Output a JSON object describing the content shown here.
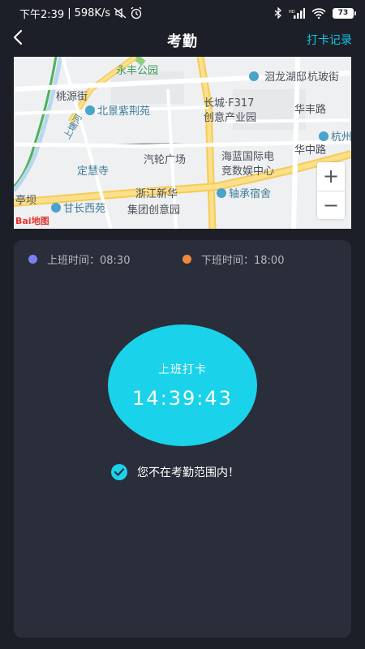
{
  "status_bar": {
    "time": "下午2:39",
    "network_speed": "598K/s",
    "battery": "73",
    "icons": [
      "mute-icon",
      "alarm-icon",
      "bluetooth-icon",
      "signal-icon",
      "wifi-icon",
      "battery-icon"
    ]
  },
  "nav": {
    "title": "考勤",
    "action_label": "打卡记录",
    "back_icon": "chevron-left-icon"
  },
  "map": {
    "pois": [
      "永丰公园",
      "洄龙湖邸",
      "杭玻街",
      "桃源街",
      "北景紫荆苑",
      "长城·F317",
      "创意产业园",
      "华丰路",
      "杭州",
      "汽轮广场",
      "海蓝国际电",
      "竞数娱中心",
      "华中路",
      "定慧寺",
      "甘长西苑",
      "浙江新华",
      "集团创意园",
      "轴承宿舍",
      "上塘河",
      "亭坝"
    ],
    "zoom_in_label": "+",
    "zoom_out_label": "−",
    "logo_text": "Bai地图"
  },
  "attendance": {
    "on_duty": {
      "label": "上班时间：08:30",
      "color": "#7b7ff0"
    },
    "off_duty": {
      "label": "下班时间：18:00",
      "color": "#f08a3c"
    },
    "punch_label": "上班打卡",
    "punch_time": "14:39:43",
    "range_status": "您不在考勤范围内！",
    "accent_color": "#1ad3ea"
  }
}
